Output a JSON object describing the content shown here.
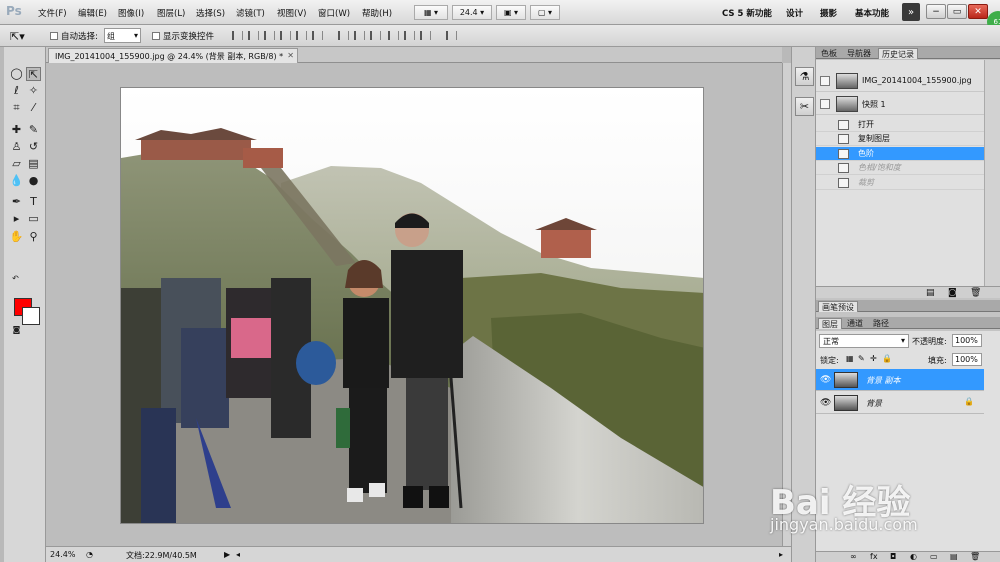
{
  "menubar": {
    "logo": "Ps",
    "menus": [
      "文件(F)",
      "编辑(E)",
      "图像(I)",
      "图层(L)",
      "选择(S)",
      "滤镜(T)",
      "视图(V)",
      "窗口(W)",
      "帮助(H)"
    ],
    "zoom_control": "24.4",
    "workspaces": [
      "CS 5 新功能",
      "设计",
      "摄影",
      "基本功能"
    ],
    "expander": "»",
    "window_buttons": [
      "−",
      "▭",
      "✕"
    ],
    "badge": "61"
  },
  "options": {
    "auto_select_label": "自动选择:",
    "auto_select_value": "组",
    "show_transform_label": "显示变换控件"
  },
  "document": {
    "tab_title": "IMG_20141004_155900.jpg @ 24.4% (背景 副本, RGB/8) *",
    "close": "✕"
  },
  "status": {
    "zoom": "24.4%",
    "doc_size": "文档:22.9M/40.5M"
  },
  "history_panel": {
    "tabs": [
      "色板",
      "导航器",
      "历史记录"
    ],
    "snapshots": [
      {
        "label": "IMG_20141004_155900.jpg"
      },
      {
        "label": "快照 1"
      }
    ],
    "states": [
      {
        "label": "打开",
        "state": "normal"
      },
      {
        "label": "复制图层",
        "state": "normal"
      },
      {
        "label": "色阶",
        "state": "selected"
      },
      {
        "label": "色相/饱和度",
        "state": "dimmed"
      },
      {
        "label": "裁剪",
        "state": "dimmed"
      }
    ]
  },
  "brush_panel": {
    "tabs": [
      "画笔预设"
    ]
  },
  "layers_panel": {
    "tabs": [
      "图层",
      "通道",
      "路径"
    ],
    "blend_mode": "正常",
    "opacity_label": "不透明度:",
    "opacity_value": "100%",
    "lock_label": "锁定:",
    "fill_label": "填充:",
    "fill_value": "100%",
    "layers": [
      {
        "name": "背景 副本",
        "selected": true,
        "locked": false
      },
      {
        "name": "背景",
        "selected": false,
        "locked": true
      }
    ]
  },
  "watermark": {
    "brand": "Bai 经验",
    "url": "jingyan.baidu.com"
  }
}
